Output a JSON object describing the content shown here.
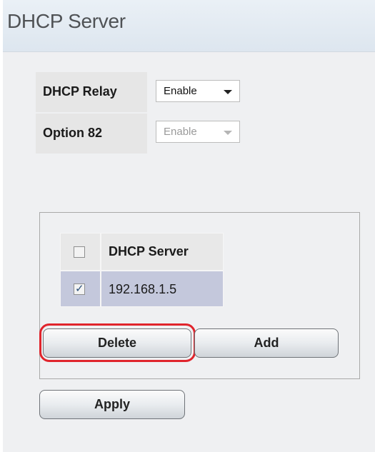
{
  "page": {
    "title": "DHCP Server"
  },
  "settings": {
    "relay": {
      "label": "DHCP Relay",
      "value": "Enable"
    },
    "option82": {
      "label": "Option 82",
      "value": "Enable"
    }
  },
  "server_table": {
    "header": "DHCP Server",
    "rows": [
      {
        "address": "192.168.1.5",
        "checked": true
      }
    ],
    "header_checked": false
  },
  "buttons": {
    "delete": "Delete",
    "add": "Add",
    "apply": "Apply"
  },
  "colors": {
    "highlight_ring": "#e0242c",
    "selected_row": "#c4c8dc",
    "header_bg": "#eaf0f6"
  },
  "icons": {
    "dropdown": "chevron-down-icon",
    "check": "checkmark-icon"
  }
}
